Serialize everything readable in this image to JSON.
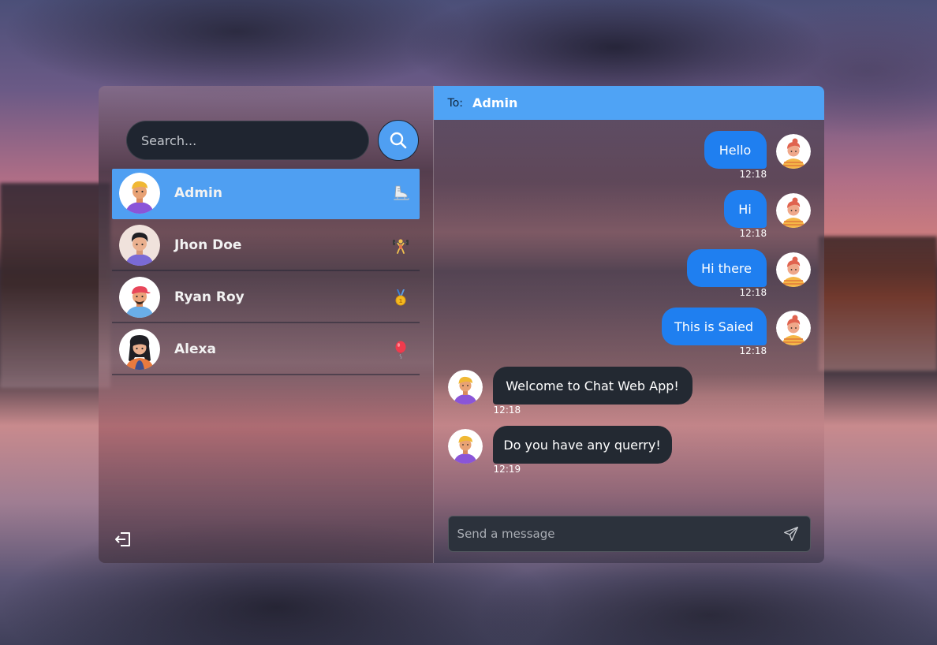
{
  "sidebar": {
    "search": {
      "placeholder": "Search..."
    },
    "contacts": [
      {
        "name": "Admin",
        "emoji": "ice-skate-icon",
        "active": true
      },
      {
        "name": "Jhon Doe",
        "emoji": "weightlifter-icon",
        "active": false
      },
      {
        "name": "Ryan Roy",
        "emoji": "gold-medal-icon",
        "active": false
      },
      {
        "name": "Alexa",
        "emoji": "balloon-icon",
        "active": false
      }
    ],
    "logout_icon": "logout-icon"
  },
  "chat": {
    "to_label": "To:",
    "recipient": "Admin",
    "messages": [
      {
        "text": "Hello",
        "time": "12:18",
        "direction": "out"
      },
      {
        "text": "Hi",
        "time": "12:18",
        "direction": "out"
      },
      {
        "text": "Hi there",
        "time": "12:18",
        "direction": "out"
      },
      {
        "text": "This is Saied",
        "time": "12:18",
        "direction": "out"
      },
      {
        "text": "Welcome to Chat Web App!",
        "time": "12:18",
        "direction": "in"
      },
      {
        "text": "Do you have any querry!",
        "time": "12:19",
        "direction": "in"
      }
    ],
    "composer": {
      "placeholder": "Send a message"
    }
  },
  "colors": {
    "accent": "#4f9ff2",
    "outgoing_bubble": "#1f7ff0",
    "incoming_bubble": "#232932",
    "header": "#4fa3f5"
  }
}
